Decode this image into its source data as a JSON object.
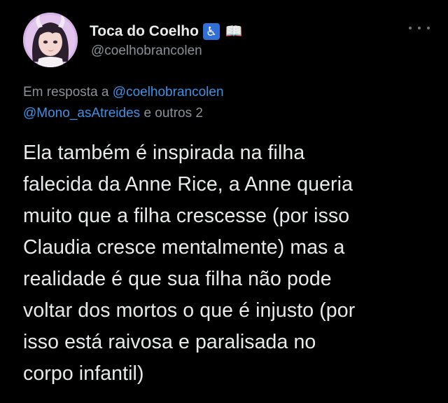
{
  "author": {
    "display_name": "Toca do Coelho",
    "badges": [
      {
        "icon": "accessibility-icon",
        "glyph": "♿"
      },
      {
        "icon": "open-book-icon",
        "glyph": "📖"
      }
    ],
    "handle": "@coelhobrancolen"
  },
  "reply": {
    "prefix": "Em resposta a",
    "mention_1": "@coelhobrancolen",
    "mention_2": "@Mono_asAtreides",
    "suffix": "e outros 2"
  },
  "tweet": {
    "lines": [
      "Ela também é inspirada na filha",
      "falecida da Anne Rice, a Anne queria",
      "muito que a filha crescesse (por isso",
      "Claudia cresce mentalmente) mas a",
      "realidade é que sua filha não pode",
      "voltar dos mortos o que é injusto (por",
      "isso está raivosa e paralisada no",
      "corpo infantil)"
    ]
  },
  "colors": {
    "background": "#000000",
    "primary_text": "#e7e9ea",
    "secondary_text": "#8b9196",
    "link": "#3d92e6",
    "accessibility_badge": "#2f6fd6"
  }
}
